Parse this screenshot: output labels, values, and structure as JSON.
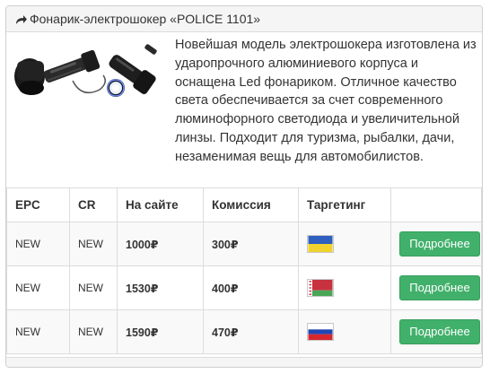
{
  "header": {
    "icon": "share-arrow-icon",
    "title": "Фонарик-электрошокер «POLICE 1101»"
  },
  "product": {
    "image": "flashlight-stun-gun-image",
    "description": "Новейшая модель электрошокера изготовлена из ударопрочного алюминиевого корпуса и оснащена Led фонариком. Отличное качество света обеспечивается за счет современного люминофорного светодиода и увеличительной линзы. Подходит для туризма, рыбалки, дачи, незаменимая вещь для автомобилистов."
  },
  "table": {
    "columns": [
      "EPC",
      "CR",
      "На сайте",
      "Комиссия",
      "Таргетинг",
      ""
    ],
    "rows": [
      {
        "epc": "NEW",
        "cr": "NEW",
        "price": "1000₽",
        "commission": "300₽",
        "country": "Ukraine",
        "button": "Подробнее"
      },
      {
        "epc": "NEW",
        "cr": "NEW",
        "price": "1530₽",
        "commission": "400₽",
        "country": "Belarus",
        "button": "Подробнее"
      },
      {
        "epc": "NEW",
        "cr": "NEW",
        "price": "1590₽",
        "commission": "470₽",
        "country": "Russia",
        "button": "Подробнее"
      }
    ]
  },
  "colors": {
    "button_bg": "#41b06b",
    "header_bg": "#f5f5f5",
    "border": "#dcdcdc"
  }
}
